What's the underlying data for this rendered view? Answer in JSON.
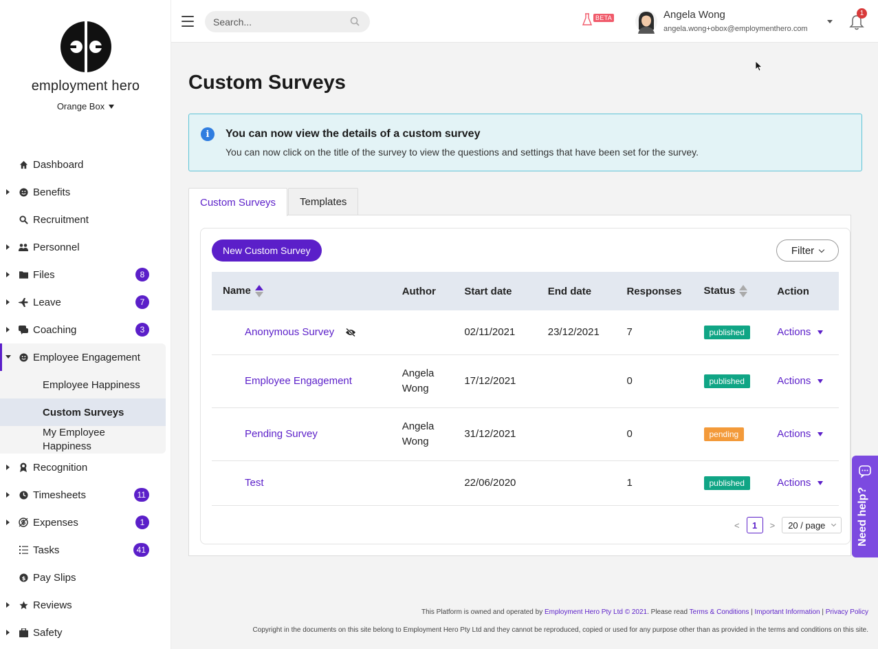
{
  "brand": {
    "name": "employment hero",
    "org": "Orange Box"
  },
  "sidebar": {
    "items": [
      {
        "label": "Dashboard",
        "icon": "home-icon",
        "arrow": false,
        "badge": ""
      },
      {
        "label": "Benefits",
        "icon": "smile-icon",
        "arrow": true,
        "badge": ""
      },
      {
        "label": "Recruitment",
        "icon": "magnify-icon",
        "arrow": false,
        "badge": ""
      },
      {
        "label": "Personnel",
        "icon": "people-icon",
        "arrow": true,
        "badge": ""
      },
      {
        "label": "Files",
        "icon": "folder-icon",
        "arrow": true,
        "badge": "8"
      },
      {
        "label": "Leave",
        "icon": "plane-icon",
        "arrow": true,
        "badge": "7"
      },
      {
        "label": "Coaching",
        "icon": "chat-icon",
        "arrow": true,
        "badge": "3"
      },
      {
        "label": "Employee Engagement",
        "icon": "smile-icon",
        "arrow": "down",
        "badge": ""
      }
    ],
    "sub_items": [
      {
        "label": "Employee Happiness"
      },
      {
        "label": "Custom Surveys"
      },
      {
        "label": "My Employee Happiness"
      }
    ],
    "items_after": [
      {
        "label": "Recognition",
        "icon": "award-icon",
        "arrow": true,
        "badge": ""
      },
      {
        "label": "Timesheets",
        "icon": "clock-icon",
        "arrow": true,
        "badge": "11"
      },
      {
        "label": "Expenses",
        "icon": "dollar-icon",
        "arrow": true,
        "badge": "1"
      },
      {
        "label": "Tasks",
        "icon": "list-icon",
        "arrow": true,
        "badge": "41"
      },
      {
        "label": "Pay Slips",
        "icon": "payslip-icon",
        "arrow": false,
        "badge": ""
      },
      {
        "label": "Reviews",
        "icon": "star-icon",
        "arrow": true,
        "badge": ""
      },
      {
        "label": "Safety",
        "icon": "safety-icon",
        "arrow": true,
        "badge": ""
      }
    ]
  },
  "header": {
    "search_placeholder": "Search...",
    "beta_label": "BETA",
    "user_name": "Angela Wong",
    "user_email": "angela.wong+obox@employmenthero.com",
    "notifications": "1"
  },
  "main": {
    "title": "Custom Surveys",
    "info": {
      "title": "You can now view the details of a custom survey",
      "text": "You can now click on the title of the survey to view the questions and settings that have been set for the survey."
    },
    "tabs": [
      {
        "label": "Custom Surveys"
      },
      {
        "label": "Templates"
      }
    ],
    "new_button": "New Custom Survey",
    "filter_button": "Filter",
    "columns": {
      "name": "Name",
      "author": "Author",
      "start": "Start date",
      "end": "End date",
      "responses": "Responses",
      "status": "Status",
      "action": "Action"
    },
    "rows": [
      {
        "name": "Anonymous Survey",
        "anonymous": true,
        "author1": "",
        "author2": "",
        "start": "02/11/2021",
        "end": "23/12/2021",
        "responses": "7",
        "status": "published",
        "action": "Actions"
      },
      {
        "name": "Employee Engagement",
        "anonymous": false,
        "author1": "Angela",
        "author2": "Wong",
        "start": "17/12/2021",
        "end": "",
        "responses": "0",
        "status": "published",
        "action": "Actions"
      },
      {
        "name": "Pending Survey",
        "anonymous": false,
        "author1": "Angela",
        "author2": "Wong",
        "start": "31/12/2021",
        "end": "",
        "responses": "0",
        "status": "pending",
        "action": "Actions"
      },
      {
        "name": "Test",
        "anonymous": false,
        "author1": "",
        "author2": "",
        "start": "22/06/2020",
        "end": "",
        "responses": "1",
        "status": "published",
        "action": "Actions"
      }
    ],
    "pagination": {
      "prev": "<",
      "page": "1",
      "next": ">",
      "page_size": "20 / page"
    }
  },
  "footer": {
    "line1_prefix": "This Platform is owned and operated by",
    "line1_company": "Employment Hero Pty Ltd © 2021",
    "line1_mid": ". Please read",
    "link_terms": "Terms & Conditions",
    "sep": "|",
    "link_info": "Important Information",
    "link_privacy": "Privacy Policy",
    "line2": "Copyright in the documents on this site belong to Employment Hero Pty Ltd and they cannot be reproduced, copied or used for any purpose other than as provided in the terms and conditions on this site."
  },
  "help": {
    "label": "Need help?"
  },
  "colors": {
    "accent": "#5b1fc9",
    "published": "#10a585",
    "pending": "#f39a3a",
    "info_border": "#5ec3d6",
    "help": "#7c4ae0"
  }
}
